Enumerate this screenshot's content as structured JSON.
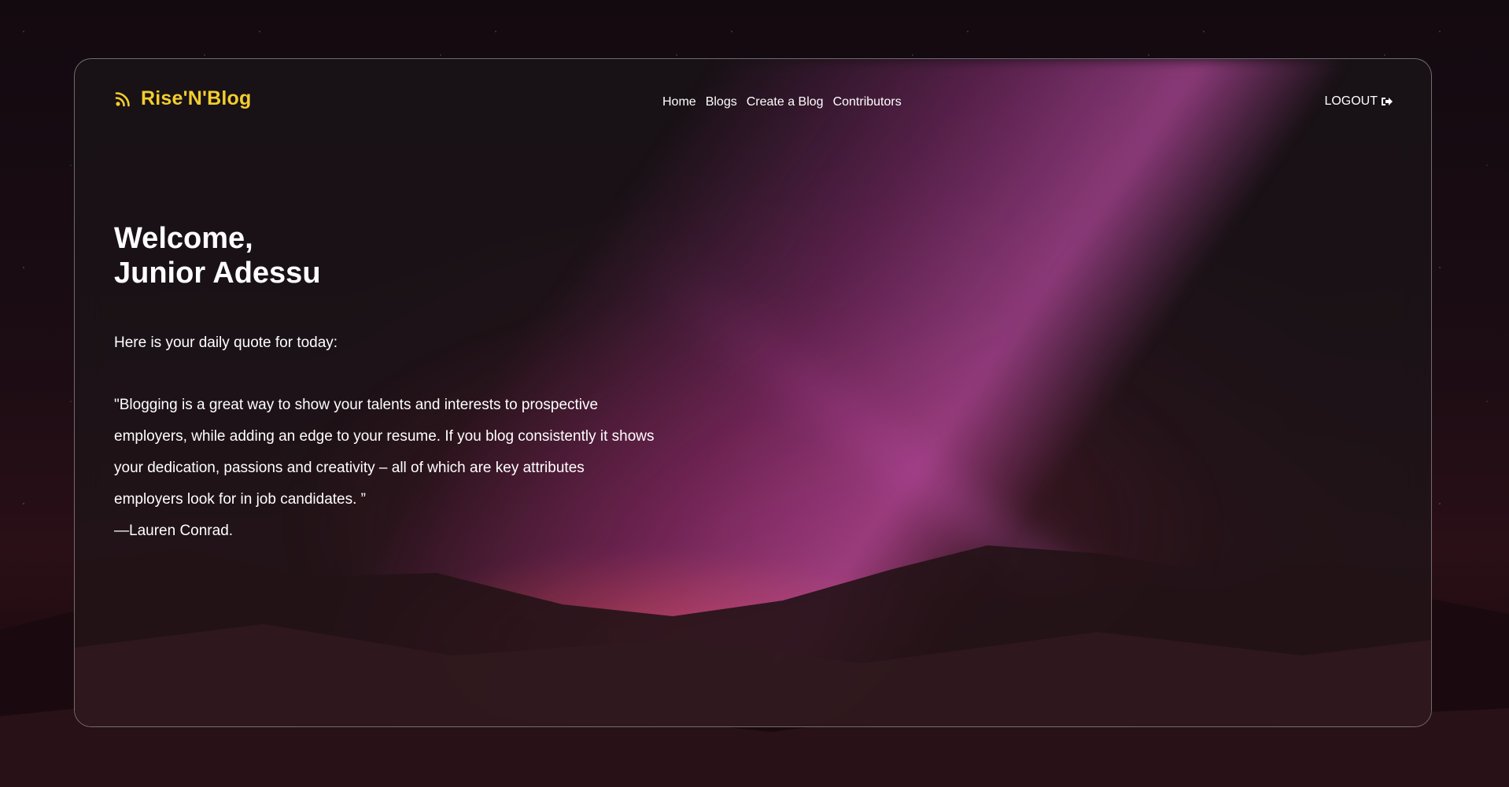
{
  "brand": {
    "name": "Rise'N'Blog",
    "icon": "rss-feed-icon",
    "color": "#f2cd2e"
  },
  "nav": {
    "items": [
      {
        "label": "Home"
      },
      {
        "label": "Blogs"
      },
      {
        "label": "Create a Blog"
      },
      {
        "label": "Contributors"
      }
    ],
    "logout_label": "LOGOUT",
    "logout_icon": "sign-out-icon"
  },
  "main": {
    "welcome_line": "Welcome,",
    "user_name": "Junior Adessu",
    "intro": "Here is your daily quote for today:",
    "quote": "\"Blogging is a great way to show your talents and interests to prospective employers, while adding an edge to your resume. If you blog consistently it shows your dedication, passions and creativity – all of which are key attributes employers look for in job candidates. ”",
    "author": "—Lauren Conrad."
  }
}
